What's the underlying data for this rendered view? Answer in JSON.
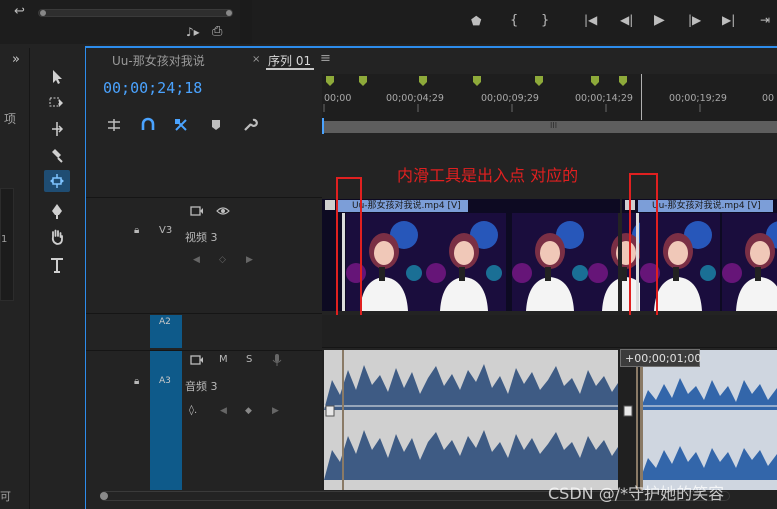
{
  "left_panel": {
    "truncated_label": "项",
    "truncated_num": "1",
    "bottom_glyph": "可"
  },
  "tools": [
    {
      "name": "selection-tool-icon"
    },
    {
      "name": "track-select-tool-icon"
    },
    {
      "name": "ripple-edit-tool-icon"
    },
    {
      "name": "razor-tool-icon"
    },
    {
      "name": "slip-tool-icon",
      "active": true
    },
    {
      "name": "pen-tool-icon"
    },
    {
      "name": "hand-tool-icon"
    },
    {
      "name": "type-tool-icon"
    }
  ],
  "timeline": {
    "tab_source": "Uu-那女孩对我说",
    "tab_sequence": "序列 01",
    "timecode": "00;00;24;18",
    "ruler_labels": [
      "00;00",
      "00;00;04;29",
      "00;00;09;29",
      "00;00;14;29",
      "00;00;19;29",
      "00"
    ],
    "annotation": "内滑工具是出入点 对应的",
    "tracks": {
      "v3": {
        "id": "V3",
        "name": "视频 3"
      },
      "a2": {
        "id": "A2"
      },
      "a3": {
        "id": "A3",
        "name": "音频 3",
        "m": "M",
        "s": "S"
      }
    },
    "clip1_label": "Uu-那女孩对我说.mp4 [V]",
    "clip2_label": "Uu-那女孩对我说.mp4 [V]",
    "tooltip": "+00;00;01;00"
  },
  "watermark": "CSDN @/*守护她的笑容",
  "colors": {
    "accent": "#2d8ceb",
    "annotation": "#e02020",
    "track_blue": "#0e5a8a",
    "clip_blue": "#7c9ed8"
  }
}
